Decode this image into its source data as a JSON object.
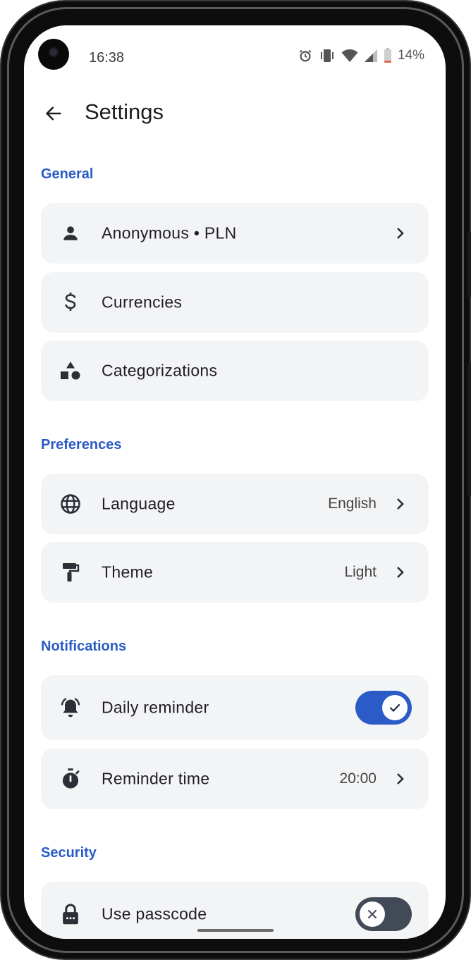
{
  "status_bar": {
    "time": "16:38",
    "battery": "14%",
    "icons": [
      "alarm-icon",
      "vibrate-icon",
      "wifi-icon",
      "signal-icon",
      "battery-icon"
    ]
  },
  "header": {
    "title": "Settings"
  },
  "sections": {
    "general": {
      "title": "General",
      "items": [
        {
          "label": "Anonymous • PLN",
          "icon": "person-icon",
          "has_chevron": true
        },
        {
          "label": "Currencies",
          "icon": "dollar-icon"
        },
        {
          "label": "Categorizations",
          "icon": "shapes-icon"
        }
      ]
    },
    "preferences": {
      "title": "Preferences",
      "items": [
        {
          "label": "Language",
          "value": "English",
          "icon": "globe-icon",
          "has_chevron": true
        },
        {
          "label": "Theme",
          "value": "Light",
          "icon": "paint-roller-icon",
          "has_chevron": true
        }
      ]
    },
    "notifications": {
      "title": "Notifications",
      "items": [
        {
          "label": "Daily reminder",
          "icon": "alarm-bell-icon",
          "toggle": true
        },
        {
          "label": "Reminder time",
          "value": "20:00",
          "icon": "timer-icon",
          "has_chevron": true
        }
      ]
    },
    "security": {
      "title": "Security",
      "items": [
        {
          "label": "Use passcode",
          "icon": "lock-icon",
          "toggle": false
        }
      ]
    }
  },
  "colors": {
    "accent": "#2a5bc6",
    "row_background": "#f3f4f6",
    "toggle_off": "#434a57"
  }
}
